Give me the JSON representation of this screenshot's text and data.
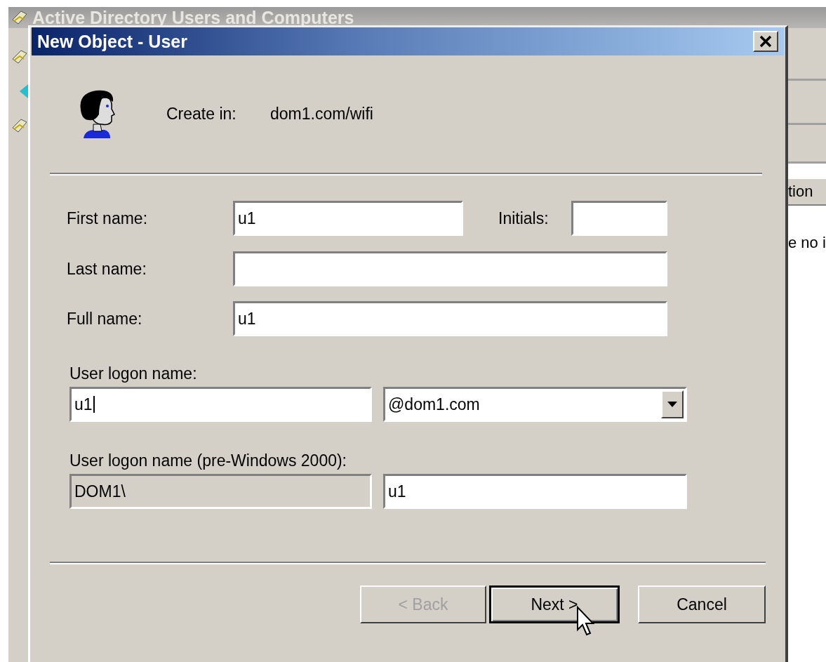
{
  "background_window": {
    "title": "Active Directory Users and Computers",
    "column_header": "tion",
    "list_text": "e no i"
  },
  "dialog": {
    "title": "New Object - User",
    "create_in_label": "Create in:",
    "create_in_value": "dom1.com/wifi",
    "first_name": {
      "label": "First name:",
      "value": "u1"
    },
    "initials": {
      "label": "Initials:"
    },
    "last_name": {
      "label": "Last name:"
    },
    "full_name": {
      "label": "Full name:",
      "value": "u1"
    },
    "logon_name": {
      "label": "User logon name:",
      "value": "u1",
      "focused": true,
      "domain": "@dom1.com"
    },
    "pre2000": {
      "label": "User logon name (pre-Windows 2000):",
      "domain": "DOM1\\",
      "value": "u1"
    },
    "buttons": [
      {
        "label": "< Back",
        "disabled": true,
        "default": false
      },
      {
        "label": "Next >",
        "disabled": false,
        "default": true
      },
      {
        "label": "Cancel",
        "disabled": false,
        "default": false
      }
    ]
  }
}
